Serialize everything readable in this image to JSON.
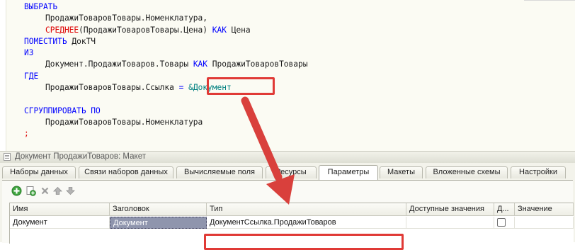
{
  "query_lines": [
    {
      "parts": [
        {
          "t": "ВЫБРАТЬ",
          "c": "kw"
        }
      ]
    },
    {
      "indent": true,
      "parts": [
        {
          "t": "ПродажиТоваровТовары.Номенклатура,",
          "c": "tx"
        }
      ]
    },
    {
      "indent": true,
      "parts": [
        {
          "t": "СРЕДНЕЕ",
          "c": "fn"
        },
        {
          "t": "(ПродажиТоваровТовары.Цена) ",
          "c": "tx"
        },
        {
          "t": "КАК",
          "c": "kw"
        },
        {
          "t": " Цена",
          "c": "tx"
        }
      ]
    },
    {
      "parts": [
        {
          "t": "ПОМЕСТИТЬ",
          "c": "kw"
        },
        {
          "t": " ДокТЧ",
          "c": "tx"
        }
      ]
    },
    {
      "parts": [
        {
          "t": "ИЗ",
          "c": "kw"
        }
      ]
    },
    {
      "indent": true,
      "parts": [
        {
          "t": "Документ.ПродажиТоваров.Товары ",
          "c": "tx"
        },
        {
          "t": "КАК",
          "c": "kw"
        },
        {
          "t": " ПродажиТоваровТовары",
          "c": "tx"
        }
      ]
    },
    {
      "parts": [
        {
          "t": "ГДЕ",
          "c": "kw"
        }
      ]
    },
    {
      "indent": true,
      "parts": [
        {
          "t": "ПродажиТоваровТовары.Ссылка ",
          "c": "tx"
        },
        {
          "t": "=",
          "c": "kw"
        },
        {
          "t": " ",
          "c": "tx"
        },
        {
          "t": "&Документ",
          "c": "par"
        }
      ]
    },
    {
      "parts": []
    },
    {
      "parts": [
        {
          "t": "СГРУППИРОВАТЬ ПО",
          "c": "kw"
        }
      ]
    },
    {
      "indent": true,
      "parts": [
        {
          "t": "ПродажиТоваровТовары.Номенклатура",
          "c": "tx"
        }
      ]
    },
    {
      "parts": [
        {
          "t": ";",
          "c": "fn"
        }
      ]
    }
  ],
  "panel": {
    "title": "Документ ПродажиТоваров: Макет",
    "tabs": [
      {
        "label": "Наборы данных",
        "active": false
      },
      {
        "label": "Связи наборов данных",
        "active": false
      },
      {
        "label": "Вычисляемые поля",
        "active": false
      },
      {
        "label": "Ресурсы",
        "active": false
      },
      {
        "label": "Параметры",
        "active": true
      },
      {
        "label": "Макеты",
        "active": false
      },
      {
        "label": "Вложенные схемы",
        "active": false
      },
      {
        "label": "Настройки",
        "active": false
      }
    ],
    "toolbar": [
      {
        "icon": "add-icon"
      },
      {
        "icon": "copy-icon"
      },
      {
        "icon": "delete-icon"
      },
      {
        "icon": "move-up-icon"
      },
      {
        "icon": "move-down-icon"
      }
    ],
    "table": {
      "columns": [
        "Имя",
        "Заголовок",
        "Тип",
        "Доступные значения",
        "Д...",
        "Значение"
      ],
      "rows": [
        {
          "name": "Документ",
          "title": "Документ",
          "type": "ДокументСсылка.ПродажиТоваров",
          "available": "",
          "checked": false,
          "value": ""
        }
      ]
    }
  },
  "colors": {
    "keyword": "#0000ff",
    "function": "#dd0000",
    "parameter": "#008080",
    "annotation": "#e03a36",
    "selection": "#8f95ad"
  }
}
